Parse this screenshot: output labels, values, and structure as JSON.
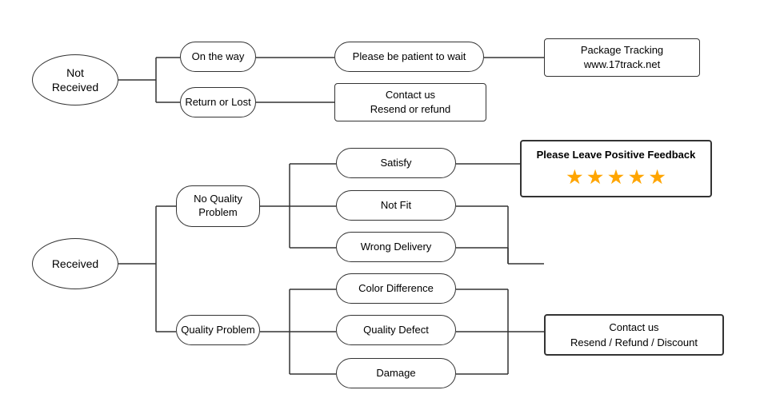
{
  "nodes": {
    "not_received": {
      "label": "Not\nReceived"
    },
    "on_the_way": {
      "label": "On the way"
    },
    "patient": {
      "label": "Please be patient to wait"
    },
    "package_tracking": {
      "label": "Package Tracking\nwww.17track.net"
    },
    "return_lost": {
      "label": "Return or Lost"
    },
    "contact_resend_refund": {
      "label": "Contact us\nResend or refund"
    },
    "received": {
      "label": "Received"
    },
    "no_quality_problem": {
      "label": "No Quality\nProblem"
    },
    "satisfy": {
      "label": "Satisfy"
    },
    "not_fit": {
      "label": "Not Fit"
    },
    "wrong_delivery": {
      "label": "Wrong Delivery"
    },
    "quality_problem": {
      "label": "Quality Problem"
    },
    "color_difference": {
      "label": "Color Difference"
    },
    "quality_defect": {
      "label": "Quality Defect"
    },
    "damage": {
      "label": "Damage"
    },
    "positive_feedback": {
      "label": "Please Leave Positive Feedback"
    },
    "stars": {
      "label": "★ ★ ★ ★ ★"
    },
    "contact_resend_refund_discount": {
      "label": "Contact us\nResend / Refund / Discount"
    }
  }
}
